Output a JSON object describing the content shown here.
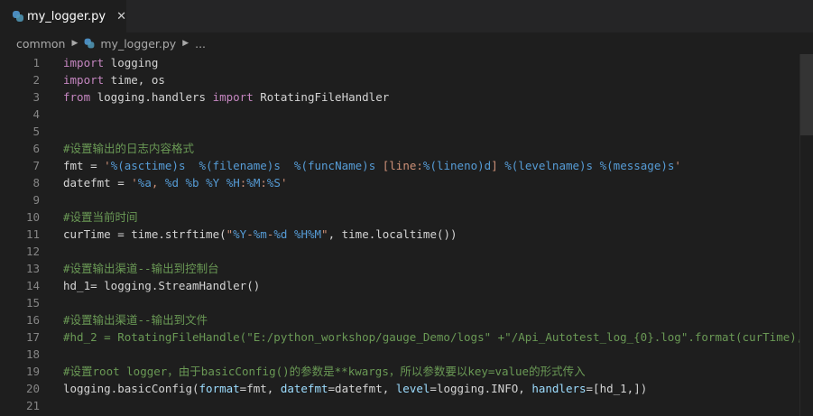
{
  "tab": {
    "title": "my_logger.py",
    "close_glyph": "✕",
    "icon": "python-icon"
  },
  "breadcrumb": {
    "folder": "common",
    "file": "my_logger.py",
    "more": "..."
  },
  "colors": {
    "keyword": "#c586c0",
    "comment": "#6a9955",
    "string": "#ce9178",
    "format_spec": "#569cd6",
    "parameter": "#9cdcfe",
    "plain": "#d4d4d4",
    "line_number": "#858585",
    "background": "#1e1e1e"
  },
  "lines": [
    {
      "n": "1",
      "tokens": [
        [
          "kw",
          "import"
        ],
        [
          "pl",
          " logging"
        ]
      ]
    },
    {
      "n": "2",
      "tokens": [
        [
          "kw",
          "import"
        ],
        [
          "pl",
          " time, os"
        ]
      ]
    },
    {
      "n": "3",
      "tokens": [
        [
          "kw",
          "from"
        ],
        [
          "pl",
          " logging.handlers "
        ],
        [
          "kw",
          "import"
        ],
        [
          "pl",
          " RotatingFileHandler"
        ]
      ]
    },
    {
      "n": "4",
      "tokens": []
    },
    {
      "n": "5",
      "tokens": []
    },
    {
      "n": "6",
      "tokens": [
        [
          "cm",
          "#设置输出的日志内容格式"
        ]
      ]
    },
    {
      "n": "7",
      "tokens": [
        [
          "pl",
          "fmt = "
        ],
        [
          "str",
          "'"
        ],
        [
          "fmt",
          "%(asctime)s"
        ],
        [
          "str",
          "  "
        ],
        [
          "fmt",
          "%(filename)s"
        ],
        [
          "str",
          "  "
        ],
        [
          "fmt",
          "%(funcName)s"
        ],
        [
          "str",
          " [line:"
        ],
        [
          "fmt",
          "%(lineno)d"
        ],
        [
          "str",
          "] "
        ],
        [
          "fmt",
          "%(levelname)s"
        ],
        [
          "str",
          " "
        ],
        [
          "fmt",
          "%(message)s"
        ],
        [
          "str",
          "'"
        ]
      ]
    },
    {
      "n": "8",
      "tokens": [
        [
          "pl",
          "datefmt = "
        ],
        [
          "str",
          "'"
        ],
        [
          "fmt",
          "%a"
        ],
        [
          "str",
          ", "
        ],
        [
          "fmt",
          "%d"
        ],
        [
          "str",
          " "
        ],
        [
          "fmt",
          "%b"
        ],
        [
          "str",
          " "
        ],
        [
          "fmt",
          "%Y"
        ],
        [
          "str",
          " "
        ],
        [
          "fmt",
          "%H"
        ],
        [
          "str",
          ":"
        ],
        [
          "fmt",
          "%M"
        ],
        [
          "str",
          ":"
        ],
        [
          "fmt",
          "%S"
        ],
        [
          "str",
          "'"
        ]
      ]
    },
    {
      "n": "9",
      "tokens": []
    },
    {
      "n": "10",
      "tokens": [
        [
          "cm",
          "#设置当前时间"
        ]
      ]
    },
    {
      "n": "11",
      "tokens": [
        [
          "pl",
          "curTime = time.strftime("
        ],
        [
          "str",
          "\""
        ],
        [
          "fmt",
          "%Y"
        ],
        [
          "str",
          "-"
        ],
        [
          "fmt",
          "%m"
        ],
        [
          "str",
          "-"
        ],
        [
          "fmt",
          "%d"
        ],
        [
          "str",
          " "
        ],
        [
          "fmt",
          "%H%M"
        ],
        [
          "str",
          "\""
        ],
        [
          "pl",
          ", time.localtime())"
        ]
      ]
    },
    {
      "n": "12",
      "tokens": []
    },
    {
      "n": "13",
      "tokens": [
        [
          "cm",
          "#设置输出渠道--输出到控制台"
        ]
      ]
    },
    {
      "n": "14",
      "tokens": [
        [
          "pl",
          "hd_1= logging.StreamHandler()"
        ]
      ]
    },
    {
      "n": "15",
      "tokens": []
    },
    {
      "n": "16",
      "tokens": [
        [
          "cm",
          "#设置输出渠道--输出到文件"
        ]
      ]
    },
    {
      "n": "17",
      "tokens": [
        [
          "cm",
          "#hd_2 = RotatingFileHandle(\"E:/python_workshop/gauge_Demo/logs\" +\"/Api_Autotest_log_{0}.log\".format(curTime),"
        ]
      ]
    },
    {
      "n": "18",
      "tokens": []
    },
    {
      "n": "19",
      "tokens": [
        [
          "cm",
          "#设置root logger，由于basicConfig()的参数是**kwargs，所以参数要以key=value的形式传入"
        ]
      ]
    },
    {
      "n": "20",
      "tokens": [
        [
          "pl",
          "logging.basicConfig("
        ],
        [
          "pm",
          "format"
        ],
        [
          "pl",
          "=fmt, "
        ],
        [
          "pm",
          "datefmt"
        ],
        [
          "pl",
          "=datefmt, "
        ],
        [
          "pm",
          "level"
        ],
        [
          "pl",
          "=logging.INFO, "
        ],
        [
          "pm",
          "handlers"
        ],
        [
          "pl",
          "=[hd_1,])"
        ]
      ]
    },
    {
      "n": "21",
      "tokens": []
    }
  ]
}
